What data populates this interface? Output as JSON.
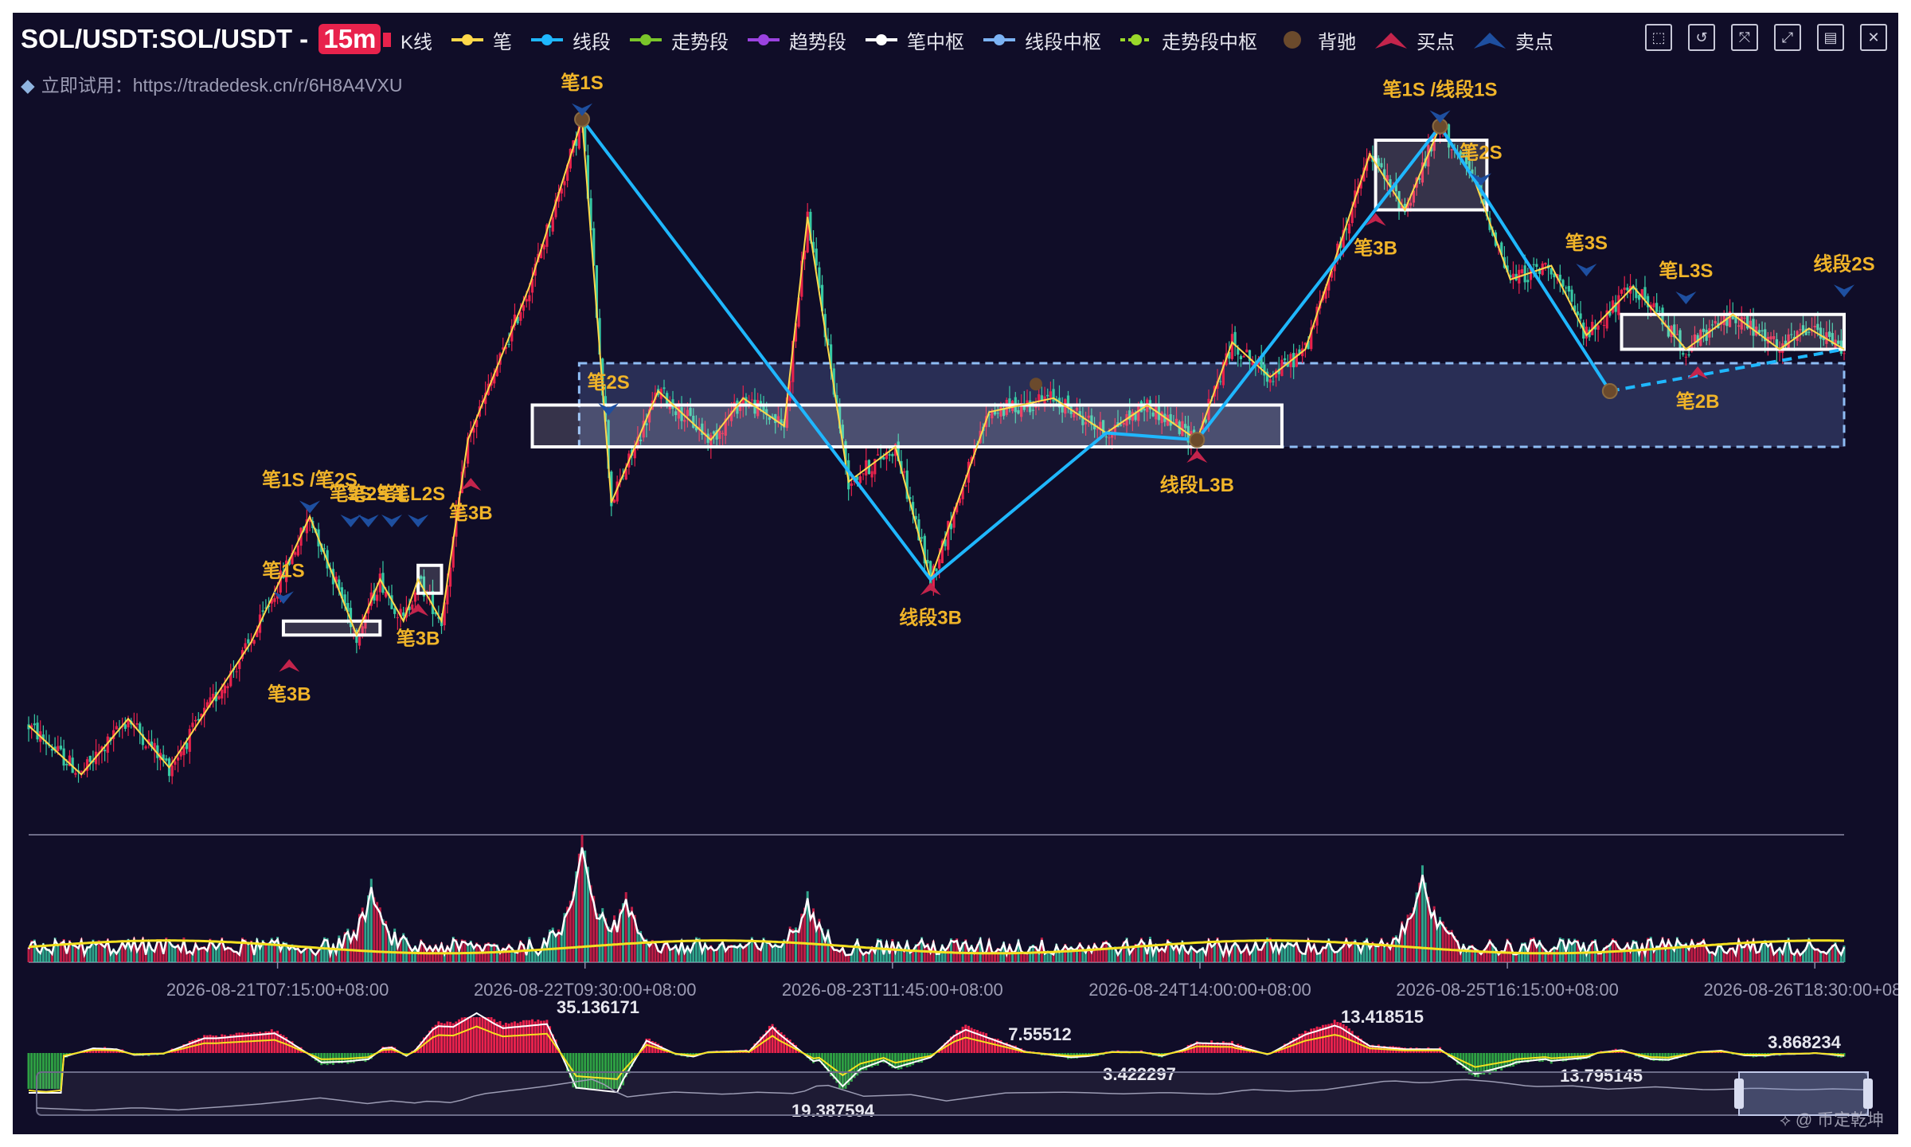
{
  "header": {
    "title": "SOL/USDT:SOL/USDT - ",
    "interval": "15m",
    "subtitle": "立即试用：https://tradedesk.cn/r/6H8A4VXU"
  },
  "legend": [
    {
      "label": "K线",
      "color": "#e8224c",
      "icon": "candle-icon"
    },
    {
      "label": "笔",
      "color": "#ffd84a",
      "icon": "line-dot-icon"
    },
    {
      "label": "线段",
      "color": "#1fb7ff",
      "icon": "line-dot-icon"
    },
    {
      "label": "走势段",
      "color": "#7ac52a",
      "icon": "line-dot-icon"
    },
    {
      "label": "趋势段",
      "color": "#9b42e0",
      "icon": "line-dot-icon"
    },
    {
      "label": "笔中枢",
      "color": "#ffffff",
      "icon": "line-dot-icon"
    },
    {
      "label": "线段中枢",
      "color": "#7cb3f4",
      "icon": "line-dot-icon"
    },
    {
      "label": "走势段中枢",
      "color": "#9ad82a",
      "icon": "dashed-dot-icon"
    },
    {
      "label": "背驰",
      "color": "#6b4a2c",
      "icon": "circle-icon"
    },
    {
      "label": "买点",
      "color": "#c4244c",
      "icon": "up-arrow-icon"
    },
    {
      "label": "卖点",
      "color": "#1e4fa0",
      "icon": "down-arrow-icon"
    }
  ],
  "toolbar": [
    {
      "name": "zoom-area-tool",
      "glyph": "⬚"
    },
    {
      "name": "zoom-reset-tool",
      "glyph": "↺"
    },
    {
      "name": "lasso-select-tool",
      "glyph": "⤧"
    },
    {
      "name": "expand-tool",
      "glyph": "⤢"
    },
    {
      "name": "data-view-tool",
      "glyph": "▤"
    },
    {
      "name": "clear-tool",
      "glyph": "✕"
    }
  ],
  "colors": {
    "up": "#e8224c",
    "down": "#37c9a4",
    "bi": "#ffd84a",
    "seg": "#1fb7ff",
    "buy": "#c4244c",
    "sell": "#1e4fa0",
    "label": "#f0b429",
    "background": "#100d28"
  },
  "chart_data": {
    "type": "line",
    "x_axis_ticks": [
      "2026-08-21T07:15:00+08:00",
      "2026-08-22T09:30:00+08:00",
      "2026-08-23T11:45:00+08:00",
      "2026-08-24T14:00:00+08:00",
      "2026-08-25T16:15:00+08:00",
      "2026-08-26T18:30:00+08:00"
    ],
    "x_start": "2026-08-20T10:00:00+08:00",
    "x_end": "2026-08-26T21:00:00+08:00",
    "y_range_estimate": [
      0,
      100
    ],
    "series": [
      {
        "name": "笔",
        "type": "line",
        "points": [
          [
            "2026-08-20T10:00",
            12
          ],
          [
            "2026-08-20T14:30",
            5
          ],
          [
            "2026-08-20T18:30",
            13
          ],
          [
            "2026-08-20T22:00",
            6
          ],
          [
            "2026-08-21T05:00",
            24
          ],
          [
            "2026-08-21T10:00",
            42
          ],
          [
            "2026-08-21T14:00",
            25
          ],
          [
            "2026-08-21T16:00",
            33
          ],
          [
            "2026-08-21T18:00",
            27
          ],
          [
            "2026-08-21T19:15",
            33
          ],
          [
            "2026-08-21T21:15",
            27
          ],
          [
            "2026-08-21T23:30",
            53
          ],
          [
            "2026-08-22T04:45",
            75
          ],
          [
            "2026-08-22T09:15",
            99
          ],
          [
            "2026-08-22T11:45",
            44
          ],
          [
            "2026-08-22T15:45",
            60
          ],
          [
            "2026-08-22T20:15",
            53
          ],
          [
            "2026-08-22T23:00",
            59
          ],
          [
            "2026-08-23T02:30",
            55
          ],
          [
            "2026-08-23T04:30",
            85
          ],
          [
            "2026-08-23T08:00",
            47
          ],
          [
            "2026-08-23T12:00",
            52
          ],
          [
            "2026-08-23T15:00",
            33
          ],
          [
            "2026-08-23T20:00",
            57
          ],
          [
            "2026-08-24T01:30",
            59
          ],
          [
            "2026-08-24T06:00",
            54
          ],
          [
            "2026-08-24T09:30",
            58
          ],
          [
            "2026-08-24T13:45",
            53
          ],
          [
            "2026-08-24T16:45",
            67
          ],
          [
            "2026-08-24T20:00",
            62
          ],
          [
            "2026-08-24T23:00",
            66
          ],
          [
            "2026-08-25T04:30",
            94
          ],
          [
            "2026-08-25T07:30",
            86
          ],
          [
            "2026-08-25T10:30",
            98
          ],
          [
            "2026-08-25T13:30",
            90
          ],
          [
            "2026-08-25T16:30",
            76
          ],
          [
            "2026-08-25T20:00",
            78
          ],
          [
            "2026-08-25T23:00",
            68
          ],
          [
            "2026-08-26T03:00",
            75
          ],
          [
            "2026-08-26T07:30",
            66
          ],
          [
            "2026-08-26T11:30",
            71
          ],
          [
            "2026-08-26T15:30",
            66
          ],
          [
            "2026-08-26T18:00",
            69
          ],
          [
            "2026-08-26T21:00",
            66
          ]
        ]
      },
      {
        "name": "线段",
        "type": "line",
        "points": [
          [
            "2026-08-22T09:15",
            99
          ],
          [
            "2026-08-23T15:00",
            33
          ],
          [
            "2026-08-24T06:00",
            54
          ],
          [
            "2026-08-24T13:45",
            53
          ],
          [
            "2026-08-25T10:30",
            98
          ],
          [
            "2026-08-26T01:00",
            60
          ],
          [
            "2026-08-26T21:00",
            66
          ]
        ]
      },
      {
        "name": "笔中枢",
        "type": "box",
        "boxes": [
          {
            "from": "2026-08-21T07:45",
            "to": "2026-08-21T16:00",
            "low": 25,
            "high": 27
          },
          {
            "from": "2026-08-21T19:15",
            "to": "2026-08-21T21:15",
            "low": 31,
            "high": 35
          },
          {
            "from": "2026-08-22T05:00",
            "to": "2026-08-24T21:00",
            "low": 52,
            "high": 58
          },
          {
            "from": "2026-08-25T05:00",
            "to": "2026-08-25T14:30",
            "low": 86,
            "high": 96
          },
          {
            "from": "2026-08-26T02:00",
            "to": "2026-08-26T21:00",
            "low": 66,
            "high": 71
          }
        ]
      },
      {
        "name": "线段中枢",
        "type": "box",
        "boxes": [
          {
            "from": "2026-08-22T09:00",
            "to": "2026-08-26T21:00",
            "low": 52,
            "high": 64
          }
        ]
      }
    ],
    "signals": [
      {
        "label": "笔1S",
        "t": "2026-08-21T07:45",
        "v": 29,
        "type": "sell"
      },
      {
        "label": "笔3B",
        "t": "2026-08-21T08:15",
        "v": 22,
        "type": "buy"
      },
      {
        "label": "笔1S /笔2S",
        "t": "2026-08-21T10:00",
        "v": 42,
        "type": "sell"
      },
      {
        "label": "笔2S",
        "t": "2026-08-21T13:30",
        "v": 40,
        "type": "sell"
      },
      {
        "label": "笔2S",
        "t": "2026-08-21T15:00",
        "v": 40,
        "type": "sell"
      },
      {
        "label": "笔1",
        "t": "2026-08-21T17:00",
        "v": 40,
        "type": "sell"
      },
      {
        "label": "笔L2S",
        "t": "2026-08-21T19:15",
        "v": 40,
        "type": "sell"
      },
      {
        "label": "笔3B",
        "t": "2026-08-21T19:15",
        "v": 30,
        "type": "buy"
      },
      {
        "label": "笔3B",
        "t": "2026-08-21T23:45",
        "v": 48,
        "type": "buy"
      },
      {
        "label": "笔1S",
        "t": "2026-08-22T09:15",
        "v": 99,
        "type": "sell"
      },
      {
        "label": "笔2S",
        "t": "2026-08-22T11:30",
        "v": 56,
        "type": "sell"
      },
      {
        "label": "线段3B",
        "t": "2026-08-23T15:00",
        "v": 33,
        "type": "buy"
      },
      {
        "label": "线段L3B",
        "t": "2026-08-24T13:45",
        "v": 52,
        "type": "buy"
      },
      {
        "label": "笔1S /线段1S",
        "t": "2026-08-25T10:30",
        "v": 98,
        "type": "sell"
      },
      {
        "label": "笔3B",
        "t": "2026-08-25T05:00",
        "v": 86,
        "type": "buy"
      },
      {
        "label": "笔2S",
        "t": "2026-08-25T14:00",
        "v": 89,
        "type": "sell"
      },
      {
        "label": "笔3S",
        "t": "2026-08-25T23:00",
        "v": 76,
        "type": "sell"
      },
      {
        "label": "笔L3S",
        "t": "2026-08-26T07:30",
        "v": 72,
        "type": "sell"
      },
      {
        "label": "笔2B",
        "t": "2026-08-26T08:30",
        "v": 64,
        "type": "buy"
      },
      {
        "label": "线段2S",
        "t": "2026-08-26T21:00",
        "v": 73,
        "type": "sell"
      }
    ],
    "macd_labels": [
      "35.136171",
      "7.55512",
      "3.422297",
      "19.387594",
      "13.418515",
      "13.795145",
      "3.868234"
    ]
  },
  "footer": {
    "watermark": "@ 币定乾坤"
  }
}
